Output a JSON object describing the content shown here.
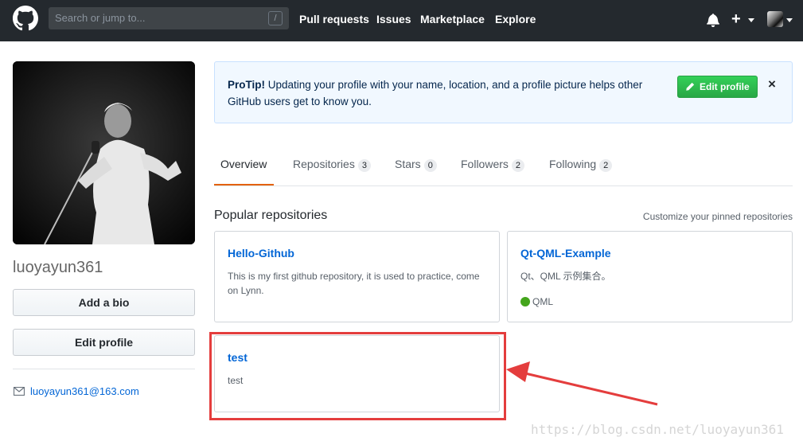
{
  "header": {
    "search_placeholder": "Search or jump to...",
    "slash_hint": "/",
    "nav": [
      "Pull requests",
      "Issues",
      "Marketplace",
      "Explore"
    ],
    "plus": "+"
  },
  "profile": {
    "username": "luoyayun361",
    "add_bio": "Add a bio",
    "edit_profile": "Edit profile",
    "email": "luoyayun361@163.com"
  },
  "protip": {
    "label": "ProTip!",
    "text": " Updating your profile with your name, location, and a profile picture helps other GitHub users get to know you.",
    "button": "Edit profile",
    "close": "×"
  },
  "tabs": [
    {
      "label": "Overview",
      "count": null
    },
    {
      "label": "Repositories",
      "count": "3"
    },
    {
      "label": "Stars",
      "count": "0"
    },
    {
      "label": "Followers",
      "count": "2"
    },
    {
      "label": "Following",
      "count": "2"
    }
  ],
  "popular": {
    "title": "Popular repositories",
    "customize": "Customize your pinned repositories",
    "repos": [
      {
        "name": "Hello-Github",
        "desc": "This is my first github repository, it is used to practice, come on Lynn."
      },
      {
        "name": "Qt-QML-Example",
        "desc": "Qt、QML 示例集合。",
        "lang": "QML",
        "lang_color": "#44a51c"
      },
      {
        "name": "test",
        "desc": "test"
      }
    ]
  },
  "watermark": "https://blog.csdn.net/luoyayun361",
  "colors": {
    "accent": "#0366d6",
    "header_bg": "#24292e",
    "green": "#28a745",
    "highlight": "#e43d3d"
  }
}
